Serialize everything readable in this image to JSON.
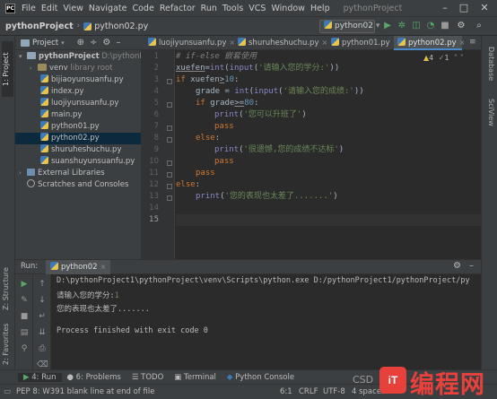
{
  "menubar": {
    "items": [
      "File",
      "Edit",
      "View",
      "Navigate",
      "Code",
      "Refactor",
      "Run",
      "Tools",
      "VCS",
      "Window",
      "Help"
    ],
    "window_title": "pythonProject"
  },
  "navbar": {
    "project": "pythonProject",
    "file": "python02.py",
    "run_config": "python02"
  },
  "project_panel": {
    "title": "Project",
    "root_name": "pythonProject",
    "root_path": "D:\\pythonPr",
    "venv": "venv",
    "venv_hint": "library root",
    "files": [
      "bijiaoyunsuanfu.py",
      "index.py",
      "luojiyunsuanfu.py",
      "main.py",
      "python01.py",
      "python02.py",
      "shuruheshuchu.py",
      "suanshuyunsuanfu.py"
    ],
    "external": "External Libraries",
    "scratches": "Scratches and Consoles",
    "selected_file": "python02.py"
  },
  "editor": {
    "tabs": [
      "luojiyunsuanfu.py",
      "shuruheshuchu.py",
      "python01.py",
      "python02.py"
    ],
    "active_tab": "python02.py",
    "inspection": {
      "warnings": "4",
      "weak": "1"
    },
    "line_numbers": [
      "1",
      "2",
      "3",
      "4",
      "5",
      "6",
      "7",
      "8",
      "9",
      "10",
      "11",
      "12",
      "13",
      "14",
      "15"
    ],
    "current_line": "15",
    "code": {
      "l1_comment": "# if-else 嵌套使用",
      "l2_var": "xuefen",
      "l2_rest_a": "=",
      "l2_fn": "int",
      "l2_paren": "(",
      "l2_fn2": "input",
      "l2_str": "'请输入您的学分:'",
      "l2_close": "))",
      "l3_if": "if",
      "l3_cond": " xuefen",
      "l3_op": ">",
      "l3_num": "10",
      "l3_colon": ":",
      "l4_var": "grade = ",
      "l4_fn": "int",
      "l4_p": "(",
      "l4_fn2": "input",
      "l4_p2": "(",
      "l4_str": "'请输入您的成绩:'",
      "l4_close": "))",
      "l5_if": "if",
      "l5_cond": " grade",
      "l5_op": ">=",
      "l5_num": "80",
      "l5_colon": ":",
      "l6_fn": "print",
      "l6_p": "(",
      "l6_str": "'您可以升班了'",
      "l6_close": ")",
      "l7_pass": "pass",
      "l8_else": "else",
      "l8_colon": ":",
      "l9_fn": "print",
      "l9_p": "(",
      "l9_str": "'很遗憾,您的成绩不达标'",
      "l9_close": ")",
      "l10_pass": "pass",
      "l11_pass": "pass",
      "l12_else": "else",
      "l12_colon": ":",
      "l13_fn": "print",
      "l13_p": "(",
      "l13_str": "'您的表现也太差了.......'",
      "l13_close": ")"
    }
  },
  "run_panel": {
    "label": "Run:",
    "config": "python02",
    "console": {
      "command": "D:\\pythonProject1\\pythonProject\\venv\\Scripts\\python.exe D:/pythonProject1/pythonProject/py",
      "prompt": "请输入您的学分:",
      "user_input": "1",
      "output": "您的表现也太差了.......",
      "finished": "Process finished with exit code 0"
    }
  },
  "left_stripe": {
    "project": "1: Project",
    "structure": "Z: Structure",
    "favorites": "2: Favorites"
  },
  "right_stripe": {
    "database": "Database",
    "sciview": "SciView"
  },
  "bottom_tabs": {
    "run": "4: Run",
    "problems": "6: Problems",
    "todo": "TODO",
    "terminal": "Terminal",
    "python_console": "Python Console"
  },
  "statusbar": {
    "message": "PEP 8: W391 blank line at end of file",
    "position": "6:1",
    "line_sep": "CRLF",
    "encoding": "UTF-8",
    "indent": "4 spaces"
  },
  "watermark": {
    "logo_text": "iT",
    "text": "编程网",
    "csd": "CSD"
  },
  "colors": {
    "accent": "#4a88c7",
    "background": "#2b2b2b",
    "panel": "#3c3f41",
    "keyword": "#cc7832",
    "string": "#6a8759",
    "number": "#6897bb",
    "watermark": "#e8413c"
  }
}
